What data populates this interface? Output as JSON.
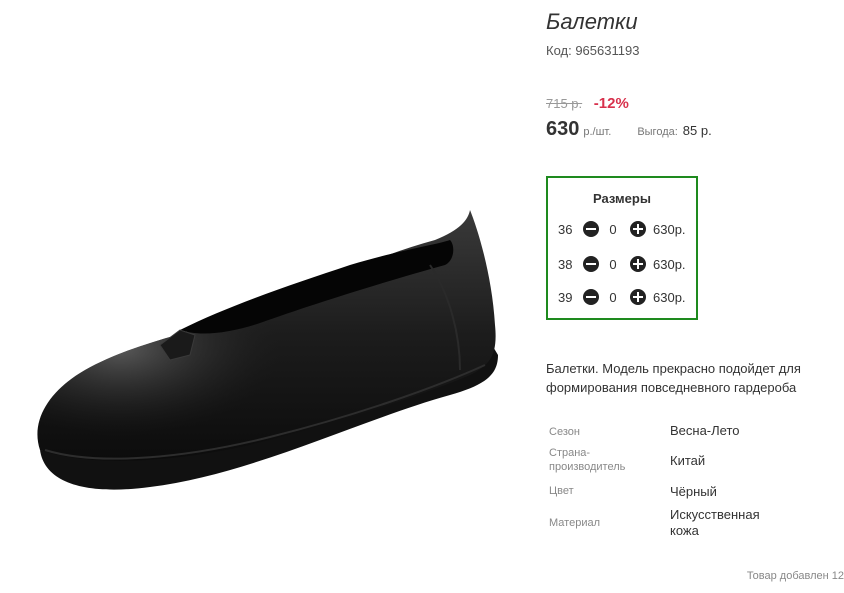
{
  "product": {
    "title": "Балетки",
    "code": "Код: 965631193",
    "old_price": "715 р.",
    "discount": "-12%",
    "price": "630",
    "price_unit": "р./шт.",
    "benefit_label": "Выгода:",
    "benefit_value": "85 р."
  },
  "sizes": {
    "title": "Размеры",
    "items": [
      {
        "size": "36",
        "qty": "0",
        "price": "630р."
      },
      {
        "size": "38",
        "qty": "0",
        "price": "630р."
      },
      {
        "size": "39",
        "qty": "0",
        "price": "630р."
      }
    ]
  },
  "description": "Балетки. Модель прекрасно подойдет для формирования повседневного гардероба",
  "specs": [
    {
      "label": "Сезон",
      "value": "Весна-Лето"
    },
    {
      "label": "Страна-производитель",
      "value": "Китай"
    },
    {
      "label": "Цвет",
      "value": "Чёрный"
    },
    {
      "label": "Материал",
      "value": "Искусственная кожа"
    }
  ],
  "added_text": "Товар добавлен 12",
  "colors": {
    "accent_border": "#1e8a1e",
    "discount": "#d8314c"
  }
}
